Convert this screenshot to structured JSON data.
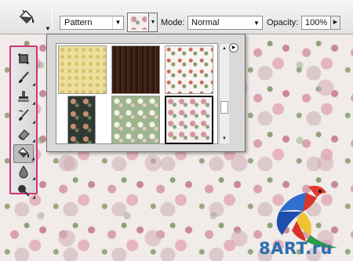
{
  "options_bar": {
    "tool_icon": "paint-bucket-icon",
    "fill_source": "Pattern",
    "mode_label": "Mode:",
    "mode_value": "Normal",
    "opacity_label": "Opacity:",
    "opacity_value": "100%"
  },
  "tools_panel": {
    "highlight_color": "#d4327a",
    "tools": [
      {
        "icon": "crop-icon"
      },
      {
        "icon": "brush-icon"
      },
      {
        "icon": "clone-stamp-icon"
      },
      {
        "icon": "history-brush-icon"
      },
      {
        "icon": "eraser-icon"
      },
      {
        "icon": "paint-bucket-icon",
        "active": true
      },
      {
        "icon": "blur-icon"
      },
      {
        "icon": "dodge-icon"
      }
    ]
  },
  "pattern_picker": {
    "patterns": [
      {
        "name": "yellow-damask"
      },
      {
        "name": "dark-wood"
      },
      {
        "name": "white-floral"
      },
      {
        "name": "dark-floral"
      },
      {
        "name": "green-floral"
      },
      {
        "name": "rose-floral",
        "selected": true
      }
    ]
  },
  "watermark": {
    "text": "8ART.ru",
    "color": "#2b6fb0"
  }
}
